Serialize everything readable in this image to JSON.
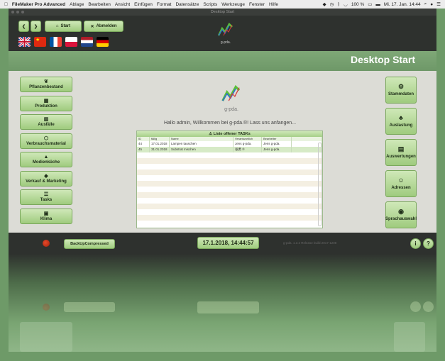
{
  "menubar": {
    "app_name": "FileMaker Pro Advanced",
    "items": [
      "Ablage",
      "Bearbeiten",
      "Ansicht",
      "Einfügen",
      "Format",
      "Datensätze",
      "Scripts",
      "Werkzeuge",
      "Fenster",
      "Hilfe"
    ],
    "battery": "100 %",
    "datetime": "Mi. 17. Jan. 14:44"
  },
  "window": {
    "title": "Desktop Start"
  },
  "toolbar": {
    "start_label": "Start",
    "logout_label": "Abmelden"
  },
  "flags": [
    "uk",
    "china",
    "france",
    "poland",
    "netherlands",
    "germany"
  ],
  "header": {
    "title": "Desktop Start"
  },
  "logo": {
    "text": "g-pda."
  },
  "left_nav": [
    {
      "label": "Pflanzenbestand",
      "icon": "plant-icon"
    },
    {
      "label": "Produktion",
      "icon": "grid-icon"
    },
    {
      "label": "Ausfälle",
      "icon": "trash-icon"
    },
    {
      "label": "Verbrauchsmaterial",
      "icon": "box-icon"
    },
    {
      "label": "Modienküche",
      "icon": "flask-icon"
    },
    {
      "label": "Verkauf & Marketing",
      "icon": "cube-icon"
    },
    {
      "label": "Tasks",
      "icon": "list-icon"
    },
    {
      "label": "Klima",
      "icon": "image-icon"
    }
  ],
  "right_nav": [
    {
      "label": "Stammdaten",
      "icon": "gear-icon"
    },
    {
      "label": "Auslastung",
      "icon": "tree-icon"
    },
    {
      "label": "Auswertungen",
      "icon": "calendar-icon"
    },
    {
      "label": "Adressen",
      "icon": "user-add-icon"
    },
    {
      "label": "Sprachauswahl",
      "icon": "globe-icon"
    }
  ],
  "welcome": "Hallo admin, Willkommen bei g-pda.®! Lass uns anfangen...",
  "tasks": {
    "title": "Liste offener TASKs",
    "columns": [
      "ID",
      "fällig",
      "Name",
      "Verantwortlich",
      "Bearbeiter"
    ],
    "rows": [
      {
        "id": "44",
        "due": "17.01.2018",
        "name": "Lampen tauschen",
        "owner": "Jens g-pda.",
        "editor": "Jens g-pda."
      },
      {
        "id": "45",
        "due": "31.01.2018",
        "name": "Substrat mischen",
        "owner": "张勇 ®",
        "editor": "Jens g-pda."
      }
    ]
  },
  "statusbar": {
    "backup_label": "BackUpCompressed",
    "clock": "17.1.2018, 14:44:57",
    "version": "g-pda. 1.3.2 Release build 2017-1208",
    "info_label": "i",
    "help_label": "?"
  }
}
